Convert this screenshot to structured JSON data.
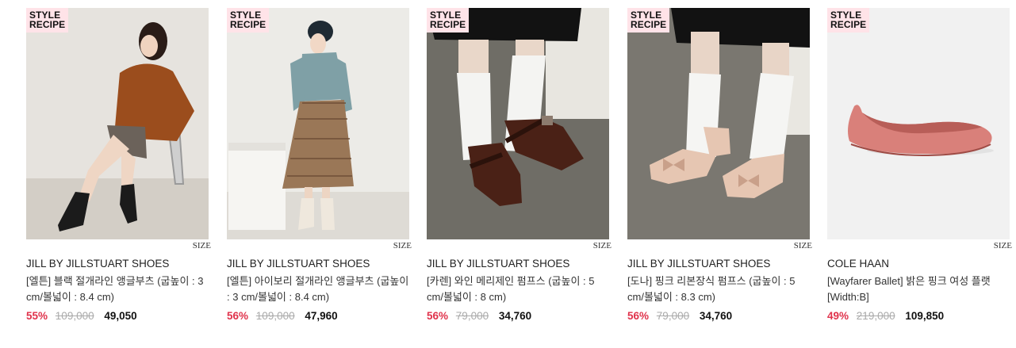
{
  "products": [
    {
      "badge": [
        "STYLE",
        "RECIPE"
      ],
      "size_label": "SIZE",
      "brand": "JILL BY JILLSTUART SHOES",
      "name": "[엘튼] 블랙 절개라인 앵글부츠 (굽높이 : 3 cm/볼넓이 : 8.4 cm)",
      "discount": "55%",
      "original_price": "109,000",
      "sale_price": "49,050"
    },
    {
      "badge": [
        "STYLE",
        "RECIPE"
      ],
      "size_label": "SIZE",
      "brand": "JILL BY JILLSTUART SHOES",
      "name": "[엘튼] 아이보리 절개라인 앵글부츠 (굽높이 : 3 cm/볼넓이 : 8.4 cm)",
      "discount": "56%",
      "original_price": "109,000",
      "sale_price": "47,960"
    },
    {
      "badge": [
        "STYLE",
        "RECIPE"
      ],
      "size_label": "SIZE",
      "brand": "JILL BY JILLSTUART SHOES",
      "name": "[카렌] 와인 메리제인 펌프스 (굽높이 : 5 cm/볼넓이 : 8 cm)",
      "discount": "56%",
      "original_price": "79,000",
      "sale_price": "34,760"
    },
    {
      "badge": [
        "STYLE",
        "RECIPE"
      ],
      "size_label": "SIZE",
      "brand": "JILL BY JILLSTUART SHOES",
      "name": "[도나] 핑크 리본장식 펌프스 (굽높이 : 5 cm/볼넓이 : 8.3 cm)",
      "discount": "56%",
      "original_price": "79,000",
      "sale_price": "34,760"
    },
    {
      "badge": [
        "STYLE",
        "RECIPE"
      ],
      "size_label": "SIZE",
      "brand": "COLE HAAN",
      "name": "[Wayfarer Ballet] 밝은 핑크 여성 플랫 [Width:B]",
      "discount": "49%",
      "original_price": "219,000",
      "sale_price": "109,850"
    }
  ]
}
